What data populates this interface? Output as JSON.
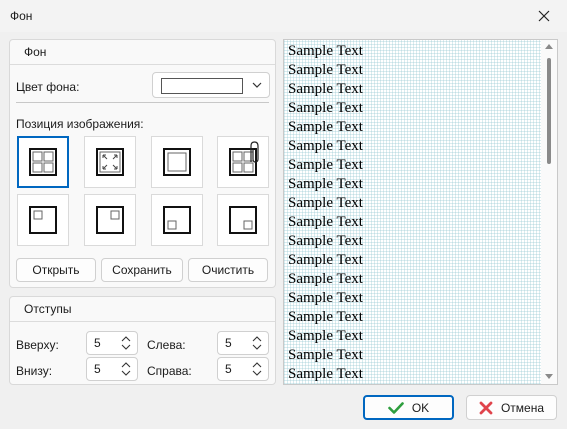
{
  "window": {
    "title": "Фон"
  },
  "background_group": {
    "title": "Фон",
    "color_label": "Цвет фона:",
    "color_value": "#ffffff",
    "position_label": "Позиция изображения:",
    "positions": [
      {
        "name": "tile",
        "selected": true
      },
      {
        "name": "stretch",
        "selected": false
      },
      {
        "name": "center",
        "selected": false
      },
      {
        "name": "tile-clip",
        "selected": false
      },
      {
        "name": "top-left",
        "selected": false
      },
      {
        "name": "top-right",
        "selected": false
      },
      {
        "name": "bottom-left",
        "selected": false
      },
      {
        "name": "bottom-right",
        "selected": false
      }
    ],
    "open_label": "Открыть",
    "save_label": "Сохранить",
    "clear_label": "Очистить"
  },
  "margins_group": {
    "title": "Отступы",
    "top_label": "Вверху:",
    "top_value": "5",
    "bottom_label": "Внизу:",
    "bottom_value": "5",
    "left_label": "Слева:",
    "left_value": "5",
    "right_label": "Справа:",
    "right_value": "5"
  },
  "preview": {
    "lines": [
      "Sample Text",
      "Sample Text",
      "Sample Text",
      "Sample Text",
      "Sample Text",
      "Sample Text",
      "Sample Text",
      "Sample Text",
      "Sample Text",
      "Sample Text",
      "Sample Text",
      "Sample Text",
      "Sample Text",
      "Sample Text",
      "Sample Text",
      "Sample Text",
      "Sample Text",
      "Sample Text"
    ]
  },
  "footer": {
    "ok_label": "OK",
    "cancel_label": "Отмена"
  },
  "colors": {
    "accent": "#0067c0",
    "ok_check": "#2e9e3e",
    "cancel_x": "#e0444c"
  }
}
